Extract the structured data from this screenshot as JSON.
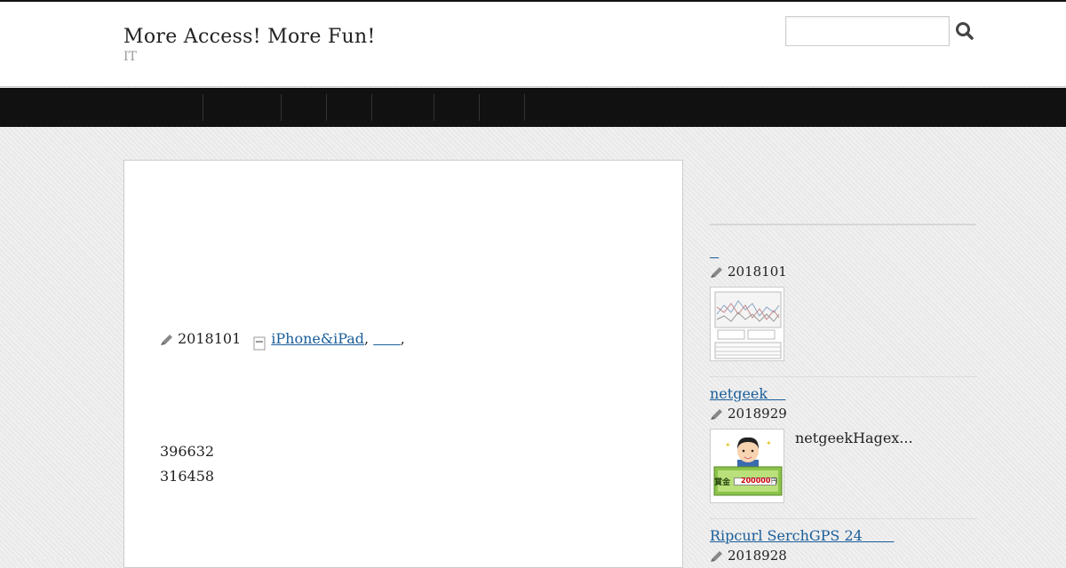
{
  "header": {
    "site_title": "More Access! More Fun!",
    "site_desc": "IT"
  },
  "search": {
    "placeholder": "",
    "button_icon": "search-icon"
  },
  "nav": {
    "items": [
      "",
      "",
      "",
      "",
      "",
      "",
      ""
    ]
  },
  "post": {
    "date": "2018101",
    "categories": [
      "iPhone&iPad",
      "      "
    ],
    "cat_sep": ",",
    "cat_trail": ",",
    "numbers": [
      "396632",
      "316458"
    ]
  },
  "sidebar": {
    "items": [
      {
        "title": "  ",
        "date": "2018101",
        "excerpt": "",
        "thumb": "chart-thumbnail"
      },
      {
        "title": "netgeek    ",
        "date": "2018929",
        "excerpt": "netgeekHagex...",
        "thumb": "prize-man-thumbnail",
        "prize_label": "賞金",
        "prize_amount": "200000",
        "prize_unit": "円"
      },
      {
        "title": "Ripcurl SerchGPS 24       ",
        "date": "2018928",
        "excerpt": ""
      }
    ]
  },
  "colors": {
    "link": "#1a5d9a",
    "nav_bg": "#111111",
    "body_bg": "#ececec"
  }
}
